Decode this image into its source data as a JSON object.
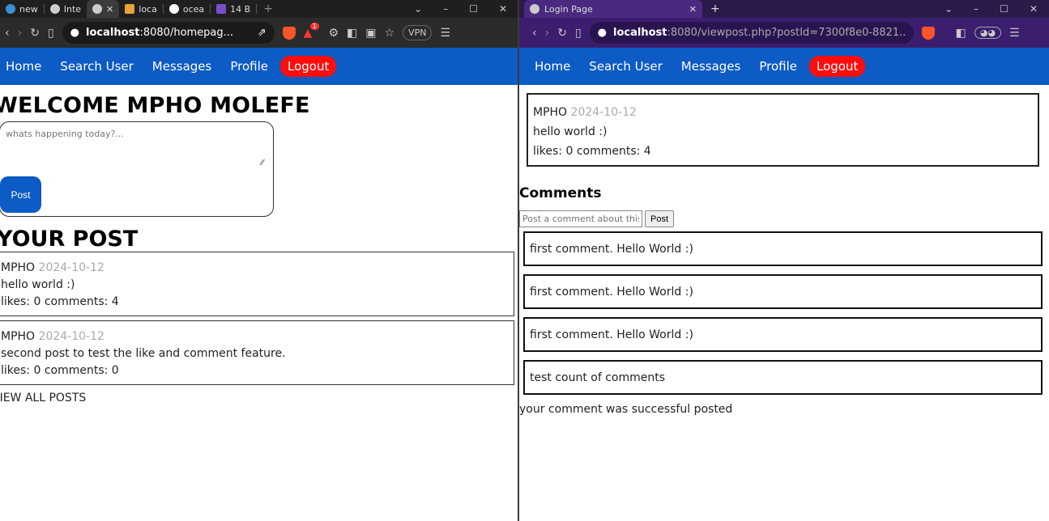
{
  "left": {
    "tabs": [
      {
        "label": "new",
        "color": "#3a8fd6"
      },
      {
        "label": "Inte",
        "color": "#cccccc"
      },
      {
        "label": "",
        "color": "#cccccc",
        "active": true
      },
      {
        "label": "loca",
        "color": "#e8a33a"
      },
      {
        "label": "ocea",
        "color": "#ffffff"
      },
      {
        "label": "14 B",
        "color": "#7b4fc9"
      }
    ],
    "close_glyph": "✕",
    "url": {
      "host": "localhost",
      "path": ":8080/homepag..."
    },
    "vpn": "VPN",
    "brave_badge": "1",
    "nav": {
      "home": "Home",
      "search": "Search User",
      "messages": "Messages",
      "profile": "Profile",
      "logout": "Logout"
    },
    "welcome": "WELCOME MPHO MOLEFE",
    "compose_placeholder": "whats happening today?...",
    "post_button": "Post",
    "your_post_heading": "YOUR POST",
    "posts": [
      {
        "author": "MPHO",
        "date": "2024-10-12",
        "body": "hello world :)",
        "stats": "likes: 0 comments: 4"
      },
      {
        "author": "MPHO",
        "date": "2024-10-12",
        "body": "second post to test the like and comment feature.",
        "stats": "likes: 0 comments: 0"
      }
    ],
    "view_all": "VIEW ALL POSTS"
  },
  "right": {
    "tab_title": "Login Page",
    "new_tab": "+",
    "url": {
      "host": "localhost",
      "path": ":8080/viewpost.php?postId=7300f8e0-8821..."
    },
    "nav": {
      "home": "Home",
      "search": "Search User",
      "messages": "Messages",
      "profile": "Profile",
      "logout": "Logout"
    },
    "post": {
      "author": "MPHO",
      "date": "2024-10-12",
      "body": "hello world :)",
      "stats": "likes: 0 comments: 4"
    },
    "comments_heading": "Comments",
    "comment_placeholder": "Post a comment about this",
    "comment_button": "Post",
    "comments": [
      "first comment. Hello World :)",
      "first comment. Hello World :)",
      "first comment. Hello World :)",
      "test count of comments"
    ],
    "success_message": "your comment was successful posted"
  },
  "colors": {
    "nav_blue": "#0d5bc4",
    "logout_red": "#ff0d0d",
    "date_gray": "#aaaaaa"
  }
}
